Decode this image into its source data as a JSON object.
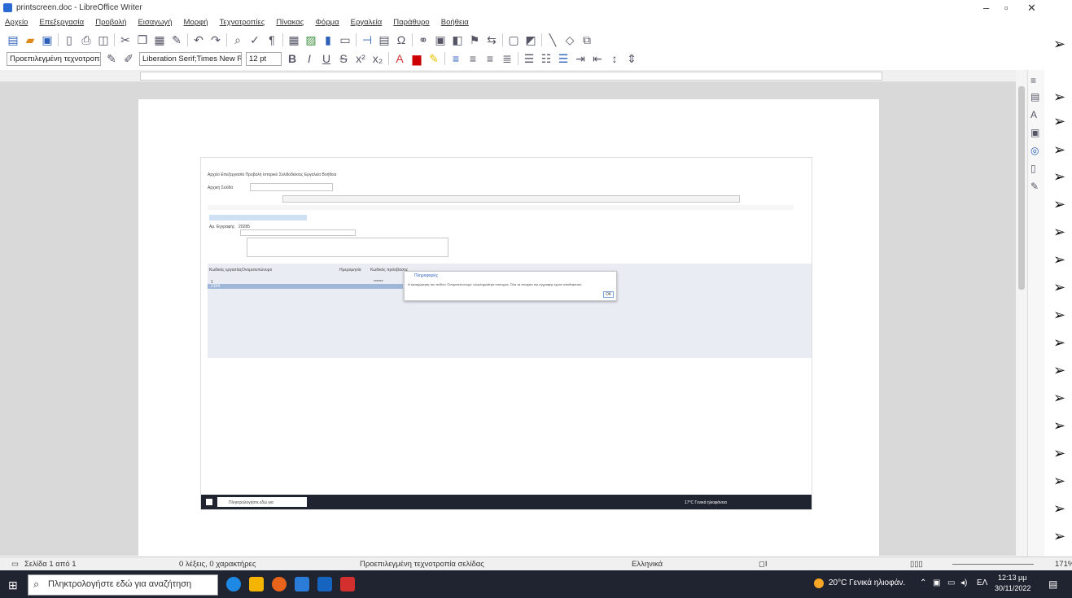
{
  "window": {
    "title": "printscreen.doc - LibreOffice Writer",
    "minimize": "–",
    "maximize": "▫",
    "close": "✕"
  },
  "menu": [
    "Αρχείο",
    "Επεξεργασία",
    "Προβολή",
    "Εισαγωγή",
    "Μορφή",
    "Τεχνοτροπίες",
    "Πίνακας",
    "Φόρμα",
    "Εργαλεία",
    "Παράθυρο",
    "Βοήθεια"
  ],
  "formatting": {
    "paragraph_style": "Προεπιλεγμένη τεχνοτροπία",
    "font_name": "Liberation Serif;Times New Roman",
    "font_size": "12 pt"
  },
  "status": {
    "page": "Σελίδα 1 από 1",
    "words": "0 λέξεις, 0 χαρακτήρες",
    "page_style": "Προεπιλεγμένη τεχνοτροπία σελίδας",
    "language": "Ελληνικά",
    "zoom": "171%"
  },
  "taskbar": {
    "search_placeholder": "Πληκτρολογήστε εδώ για αναζήτηση",
    "weather": "20°C Γενικά ηλιοφάν.",
    "lang": "ΕΛ",
    "time": "12:13 μμ",
    "date": "30/11/2022"
  },
  "embedded": {
    "menu": "Αρχείο Επεξεργασία Προβολή Ιστορικό Σελιδοδείκτες Εργαλεία Βοήθεια",
    "tab": "Αρχική Σελίδα",
    "dialog_title": "Πληροφορίες",
    "dialog_text": "Η καταχώρηση του πεδίου 'Ονοματεπώνυμο' ολοκληρώθηκε επιτυχώς. Όλα τα στοιχεία της εγγραφής έχουν αποθηκευτεί.",
    "dialog_ok": "OK",
    "col1": "Κωδικός εργασίας",
    "col2": "Ονοματεπώνυμο",
    "col3": "Ημερομηνία",
    "col4": "Κωδικός πρόσβασης",
    "row1_code": "1",
    "row2_code": "2104",
    "masked": "******",
    "field_label": "Αρ. Εγγραφής",
    "field_value": "20285",
    "weather": "17°C Γενικά ηλιοφάνεια",
    "search": "Πληκτρολογήστε εδώ για"
  }
}
